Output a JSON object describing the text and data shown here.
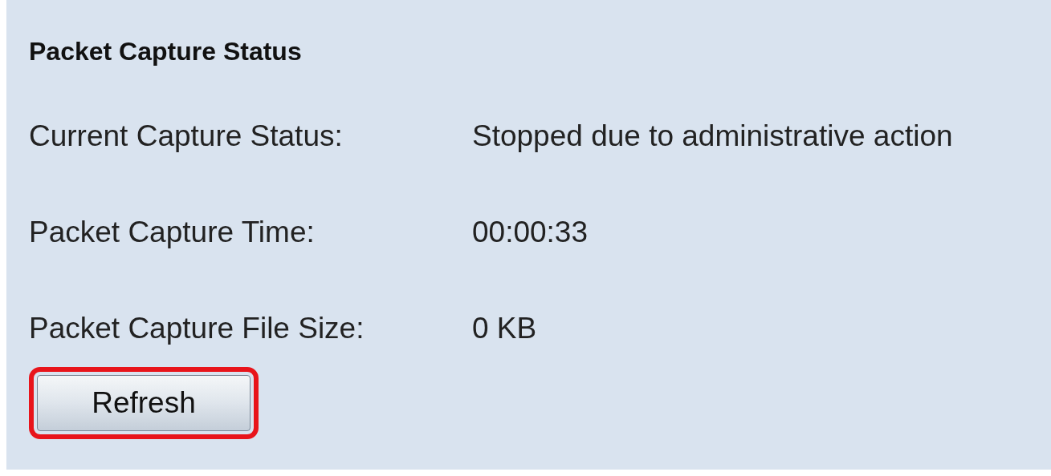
{
  "panel": {
    "title": "Packet Capture Status",
    "rows": [
      {
        "label": "Current Capture Status:",
        "value": "Stopped due to administrative action"
      },
      {
        "label": "Packet Capture Time:",
        "value": "00:00:33"
      },
      {
        "label": "Packet Capture File Size:",
        "value": "0 KB"
      }
    ],
    "button": {
      "label": "Refresh",
      "highlighted": true
    }
  }
}
